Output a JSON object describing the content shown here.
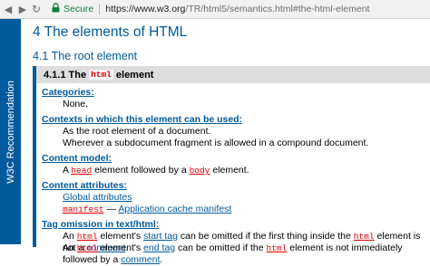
{
  "browser": {
    "back_icon": "back-arrow-icon",
    "forward_icon": "forward-arrow-icon",
    "reload_icon": "reload-icon",
    "lock_icon": "lock-icon",
    "secure_label": "Secure",
    "url_host": "https://www.w3.org",
    "url_path": "/TR/html5/semantics.html#the-html-element"
  },
  "banner": {
    "label": "W3C Recommendation",
    "color": "#005a9c"
  },
  "section": {
    "title": "4 The elements of HTML",
    "subtitle": "4.1 The root element"
  },
  "element": {
    "heading_prefix": "4.1.1 The",
    "heading_code": "html",
    "heading_suffix": "element",
    "categories": {
      "label": "Categories",
      "value": "None."
    },
    "contexts": {
      "label": "Contexts in which this element can be used",
      "values": [
        "As the root element of a document.",
        "Wherever a subdocument fragment is allowed in a compound document."
      ]
    },
    "content_model": {
      "label": "Content model",
      "pre": "A",
      "code1": "head",
      "mid": "element followed by a",
      "code2": "body",
      "post": "element."
    },
    "attributes": {
      "label": "Content attributes",
      "global_link": "Global attributes",
      "manifest_code": "manifest",
      "dash": "—",
      "manifest_link": "Application cache manifest"
    },
    "tag_omission": {
      "label": "Tag omission in text/html",
      "line1": {
        "pre": "An",
        "code": "html",
        "mid": "element's",
        "link": "start tag",
        "mid2": "can be omitted if the first thing inside the",
        "code2": "html",
        "post": "element is not a",
        "link2": "comment",
        "end": "."
      },
      "line2": {
        "pre": "An",
        "code": "html",
        "mid": "element's",
        "link": "end tag",
        "mid2": "can be omitted if the",
        "code2": "html",
        "post": "element is not immediately followed by a",
        "link2": "comment",
        "end": "."
      }
    }
  }
}
